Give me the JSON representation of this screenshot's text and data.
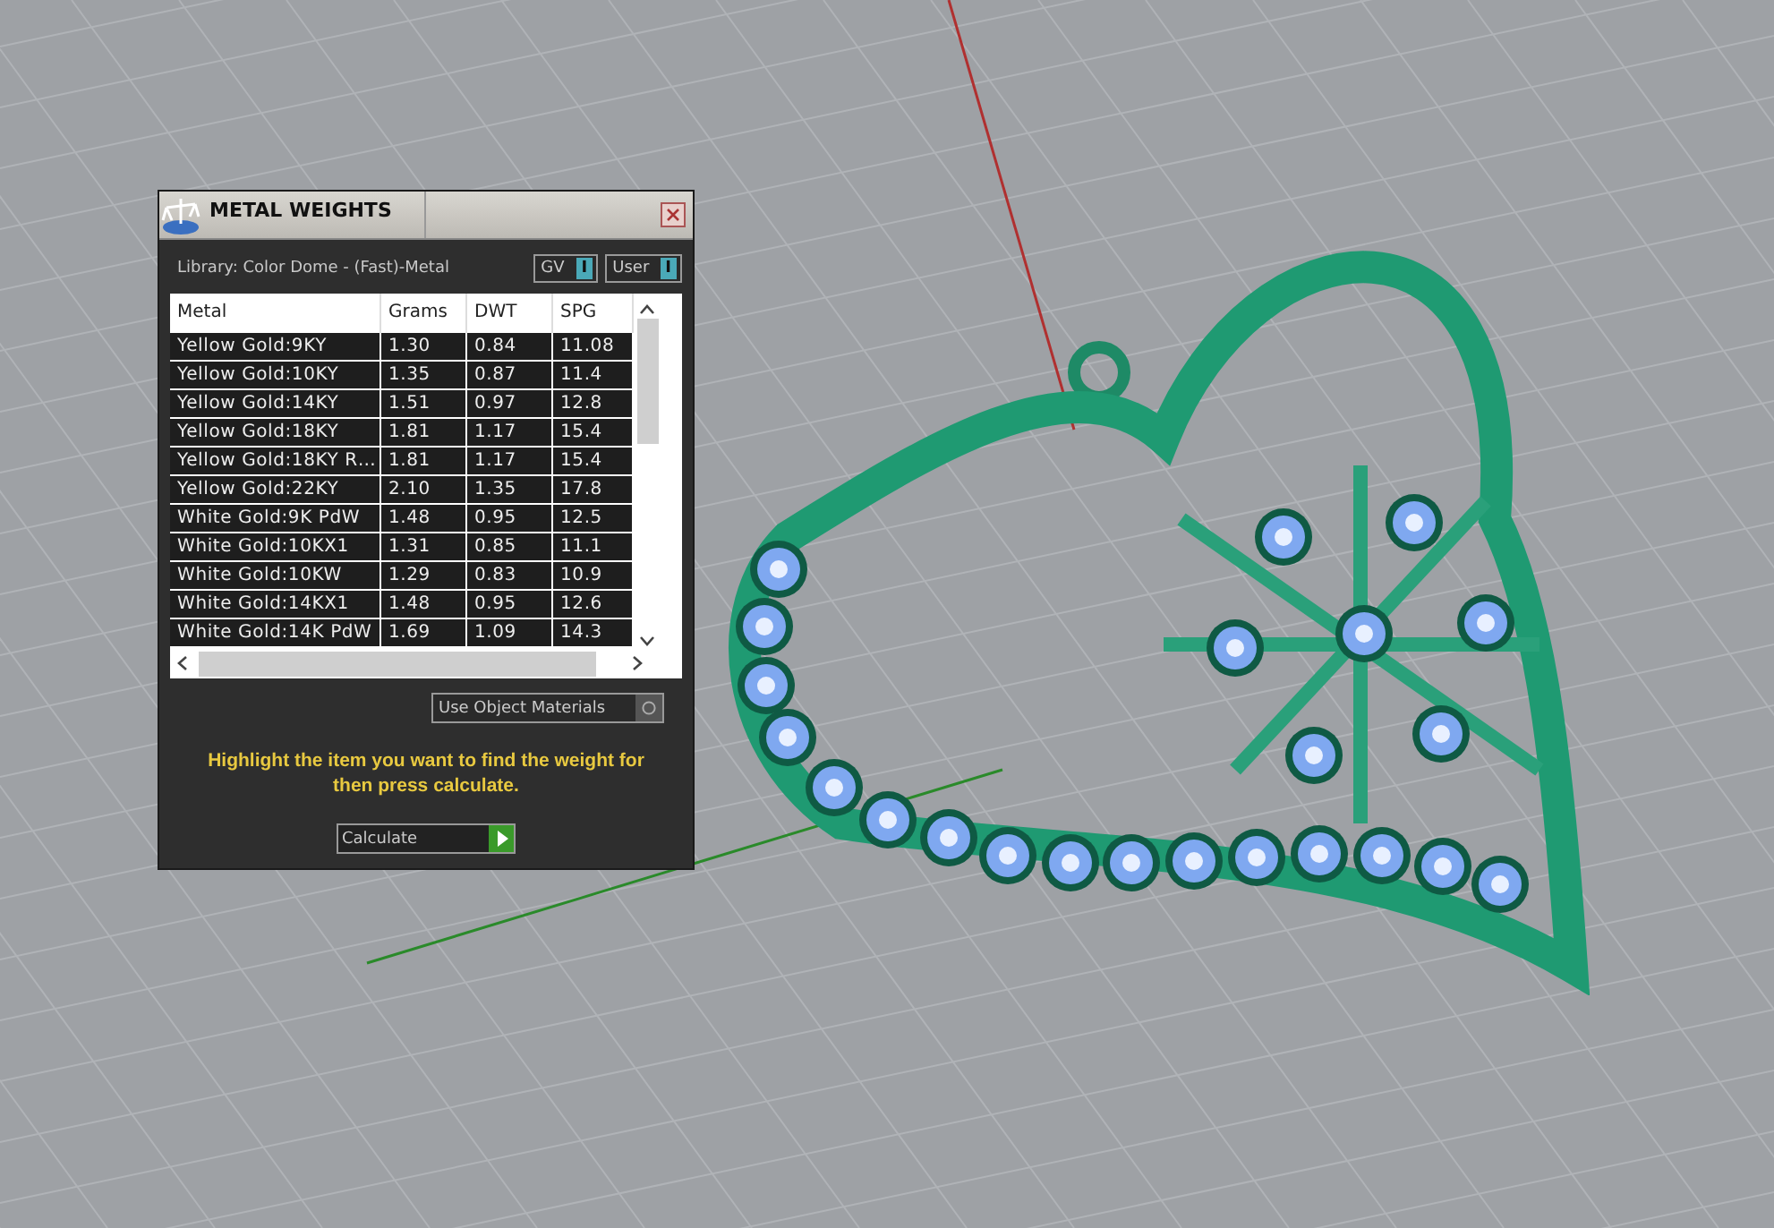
{
  "dialog": {
    "title": "METAL WEIGHTS",
    "library": "Library: Color Dome - (Fast)-Metal",
    "toggles": [
      {
        "label": "GV",
        "indicator": "I",
        "on": true
      },
      {
        "label": "User",
        "indicator": "I",
        "on": true
      }
    ],
    "table": {
      "columns": [
        "Metal",
        "Grams",
        "DWT",
        "SPG"
      ],
      "rows": [
        [
          "Yellow Gold:9KY",
          "1.30",
          "0.84",
          "11.08"
        ],
        [
          "Yellow Gold:10KY",
          "1.35",
          "0.87",
          "11.4"
        ],
        [
          "Yellow Gold:14KY",
          "1.51",
          "0.97",
          "12.8"
        ],
        [
          "Yellow Gold:18KY",
          "1.81",
          "1.17",
          "15.4"
        ],
        [
          "Yellow Gold:18KY R…",
          "1.81",
          "1.17",
          "15.4"
        ],
        [
          "Yellow Gold:22KY",
          "2.10",
          "1.35",
          "17.8"
        ],
        [
          "White Gold:9K PdW",
          "1.48",
          "0.95",
          "12.5"
        ],
        [
          "White Gold:10KX1",
          "1.31",
          "0.85",
          "11.1"
        ],
        [
          "White Gold:10KW",
          "1.29",
          "0.83",
          "10.9"
        ],
        [
          "White Gold:14KX1",
          "1.48",
          "0.95",
          "12.6"
        ],
        [
          "White Gold:14K PdW",
          "1.69",
          "1.09",
          "14.3"
        ]
      ]
    },
    "use_object_materials": {
      "label": "Use Object Materials",
      "checked": false
    },
    "hint": "Highlight the item you want to find the weight for then press calculate.",
    "calculate": {
      "label": "Calculate"
    }
  }
}
